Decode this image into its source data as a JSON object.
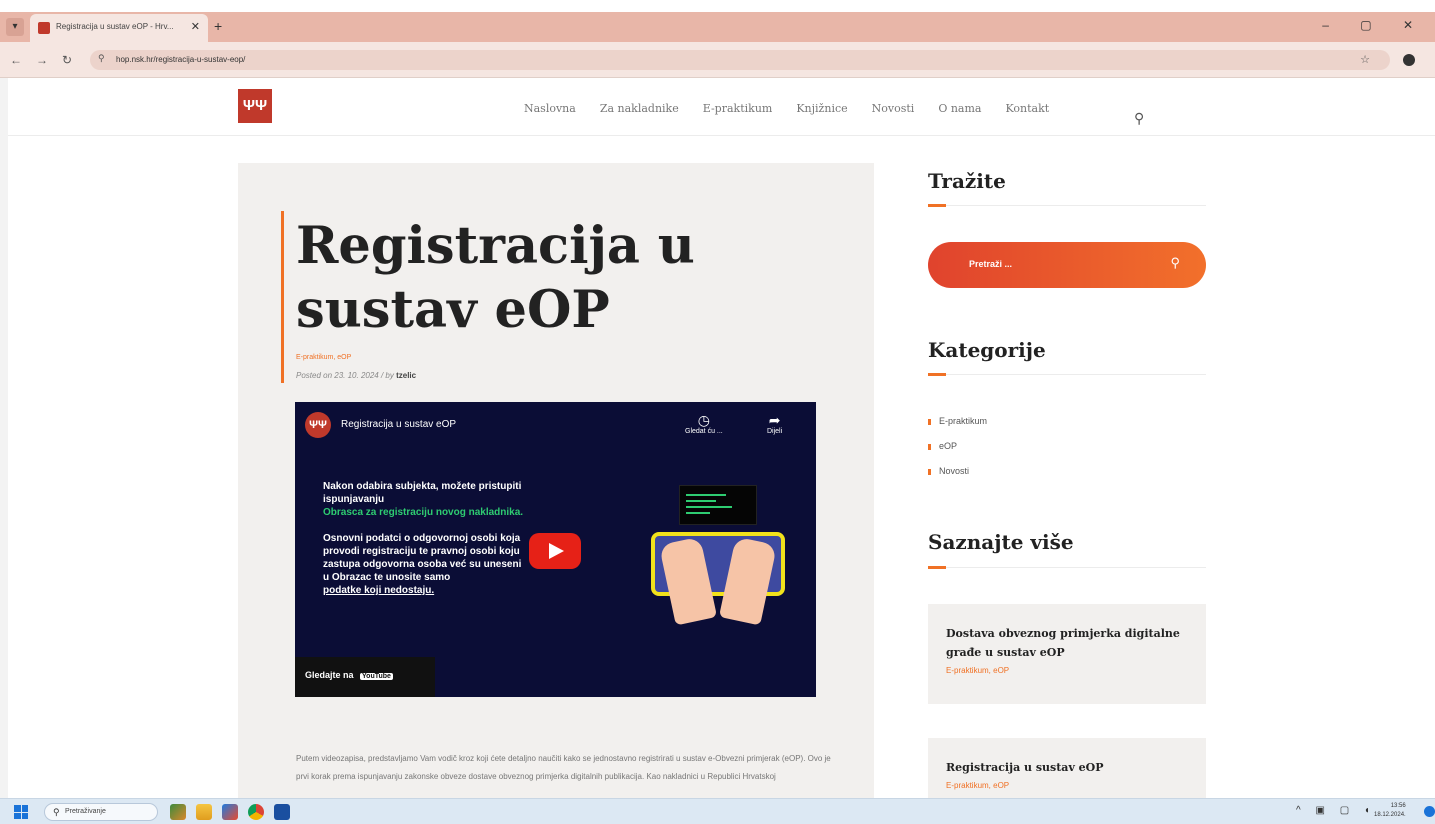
{
  "browser": {
    "tab_title": "Registracija u sustav eOP - Hrv...",
    "tab_close": "✕",
    "new_tab": "+",
    "url": "hop.nsk.hr/registracija-u-sustav-eop/",
    "window_controls": "–  ▢  ✕"
  },
  "site": {
    "logo_glyph": "ΨΨ",
    "nav": [
      "Naslovna",
      "Za nakladnike",
      "E-praktikum",
      "Knjižnice",
      "Novosti",
      "O nama",
      "Kontakt"
    ]
  },
  "post": {
    "title": "Registracija u sustav eOP",
    "categories": "E-praktikum, eOP",
    "posted_prefix": "Posted on 23. 10. 2024  /  by",
    "author": "tzelic",
    "body": "Putem videozapisa, predstavljamo Vam vodič kroz koji ćete detaljno naučiti kako se jednostavno registrirati u sustav e-Obvezni primjerak (eOP). Ovo je prvi korak prema ispunjavanju zakonske obveze dostave obveznog primjerka digitalnih publikacija. Kao nakladnici u Republici Hrvatskoj"
  },
  "video": {
    "title": "Registracija u sustav eOP",
    "watch_later": "Gledat ću ...",
    "share": "Dijeli",
    "line1": "Nakon odabira subjekta, možete pristupiti",
    "line2": "ispunjavanju",
    "line3": "Obrasca za registraciju novog nakladnika.",
    "line4": "Osnovni podatci o odgovornoj osobi koja",
    "line5": "provodi registraciju te pravnoj osobi koju",
    "line6": "zastupa odgovorna osoba već su uneseni",
    "line7": "u Obrazac te unosite samo",
    "line8": "podatke koji nedostaju.",
    "watch_on": "Gledajte na",
    "youtube": "YouTube"
  },
  "sidebar": {
    "search_title": "Tražite",
    "search_placeholder": "Pretraži ...",
    "categories_title": "Kategorije",
    "categories": [
      "E-praktikum",
      "eOP",
      "Novosti"
    ],
    "learn_title": "Saznajte više",
    "cards": [
      {
        "title": "Dostava obveznog primjerka digitalne građe u sustav eOP",
        "cats": "E-praktikum, eOP"
      },
      {
        "title": "Registracija u sustav eOP",
        "cats": "E-praktikum, eOP"
      }
    ]
  },
  "taskbar": {
    "search_placeholder": "Pretraživanje",
    "time": "13:56",
    "date": "18.12.2024."
  },
  "colors": {
    "accent": "#f07125",
    "brand_red": "#c0392b",
    "video_bg": "#0b0d36",
    "chrome": "#e8b6a8"
  }
}
